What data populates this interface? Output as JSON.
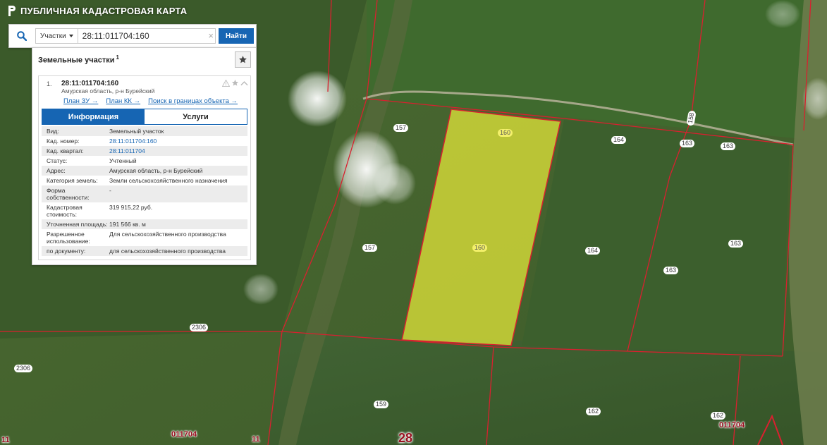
{
  "app": {
    "title": "ПУБЛИЧНАЯ КАДАСТРОВАЯ КАРТА"
  },
  "search": {
    "type_label": "Участки",
    "query": "28:11:011704:160",
    "clear_symbol": "×",
    "button_label": "Найти"
  },
  "panel": {
    "title": "Земельные участки",
    "count": "1",
    "result": {
      "index": "1.",
      "cad_number": "28:11:011704:160",
      "address": "Амурская область, р-н Бурейский",
      "links": [
        "План ЗУ →",
        "План КК →",
        "Поиск в границах объекта →"
      ],
      "tabs": [
        "Информация",
        "Услуги"
      ],
      "properties": [
        {
          "key": "Вид:",
          "value": "Земельный участок"
        },
        {
          "key": "Кад. номер:",
          "value": "28:11:011704:160"
        },
        {
          "key": "Кад. квартал:",
          "value": "28:11:011704"
        },
        {
          "key": "Статус:",
          "value": "Учтенный"
        },
        {
          "key": "Адрес:",
          "value": "Амурская область, р-н Бурейский"
        },
        {
          "key": "Категория земель:",
          "value": "Земли сельскохозяйственного назначения"
        },
        {
          "key": "Форма собственности:",
          "value": "-"
        },
        {
          "key": "Кадастровая стоимость:",
          "value": "319 915,22 руб."
        },
        {
          "key": "Уточненная площадь:",
          "value": "191 566 кв. м"
        },
        {
          "key": "Разрешенное использование:",
          "value": "Для сельскохозяйственного производства"
        },
        {
          "key": "по документу:",
          "value": "для сельскохозяйственного производства"
        }
      ]
    }
  },
  "map": {
    "plot_labels": [
      "160",
      "160",
      "157",
      "157",
      "164",
      "164",
      "163",
      "163",
      "163",
      "163",
      "2306",
      "2306",
      "159",
      "162",
      "162",
      "158"
    ],
    "quarter_labels": [
      "011704",
      "011704",
      "11",
      "11"
    ],
    "district_label": "28"
  },
  "colors": {
    "accent": "#1665b3",
    "boundary": "#d9202f",
    "selected_fill": "#e8ea3a"
  }
}
